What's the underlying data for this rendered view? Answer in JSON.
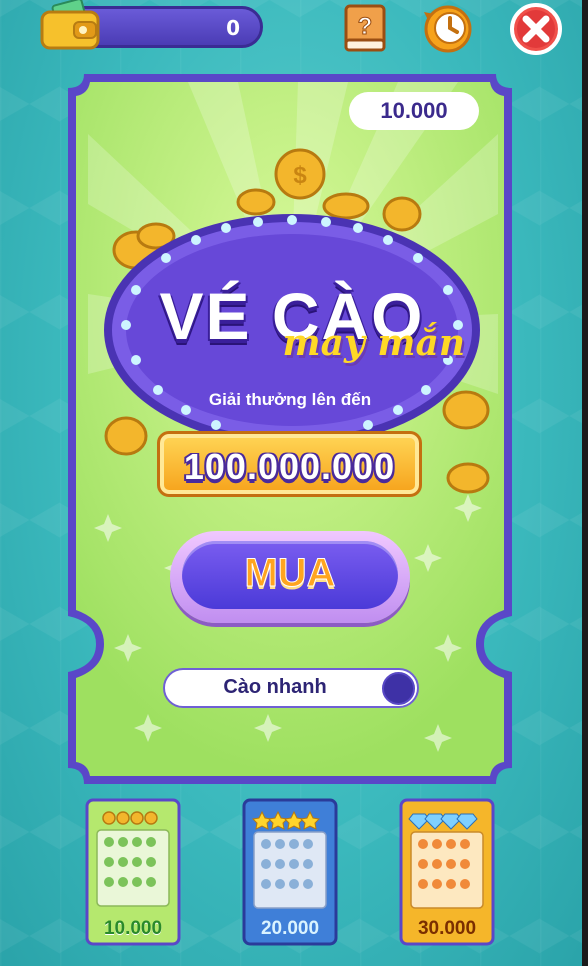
{
  "wallet": {
    "balance": "0",
    "icon": "wallet-icon"
  },
  "toolbar": {
    "help_icon": "question-book-icon",
    "history_icon": "clock-history-icon",
    "close_icon": "close-icon"
  },
  "ticket": {
    "price": "10.000",
    "title_line1": "VÉ CÀO",
    "title_line2": "may mắn",
    "prize_label": "Giải thưởng lên đến",
    "prize_value": "100.000.000",
    "buy_label": "MUA",
    "quick_scratch_label": "Cào nhanh"
  },
  "ticket_options": [
    {
      "label": "10.000",
      "theme": "green",
      "badge_icon": "coin-icon"
    },
    {
      "label": "20.000",
      "theme": "blue",
      "badge_icon": "star-icon"
    },
    {
      "label": "30.000",
      "theme": "gold",
      "badge_icon": "diamond-icon"
    }
  ],
  "colors": {
    "background": "#3bb9bd",
    "ticket_border": "#5a47c8",
    "ticket_fill": "#b8ec74",
    "accent_purple": "#4b3ad8",
    "accent_orange": "#ffa51f",
    "prize_gold": "#f6a21b"
  }
}
